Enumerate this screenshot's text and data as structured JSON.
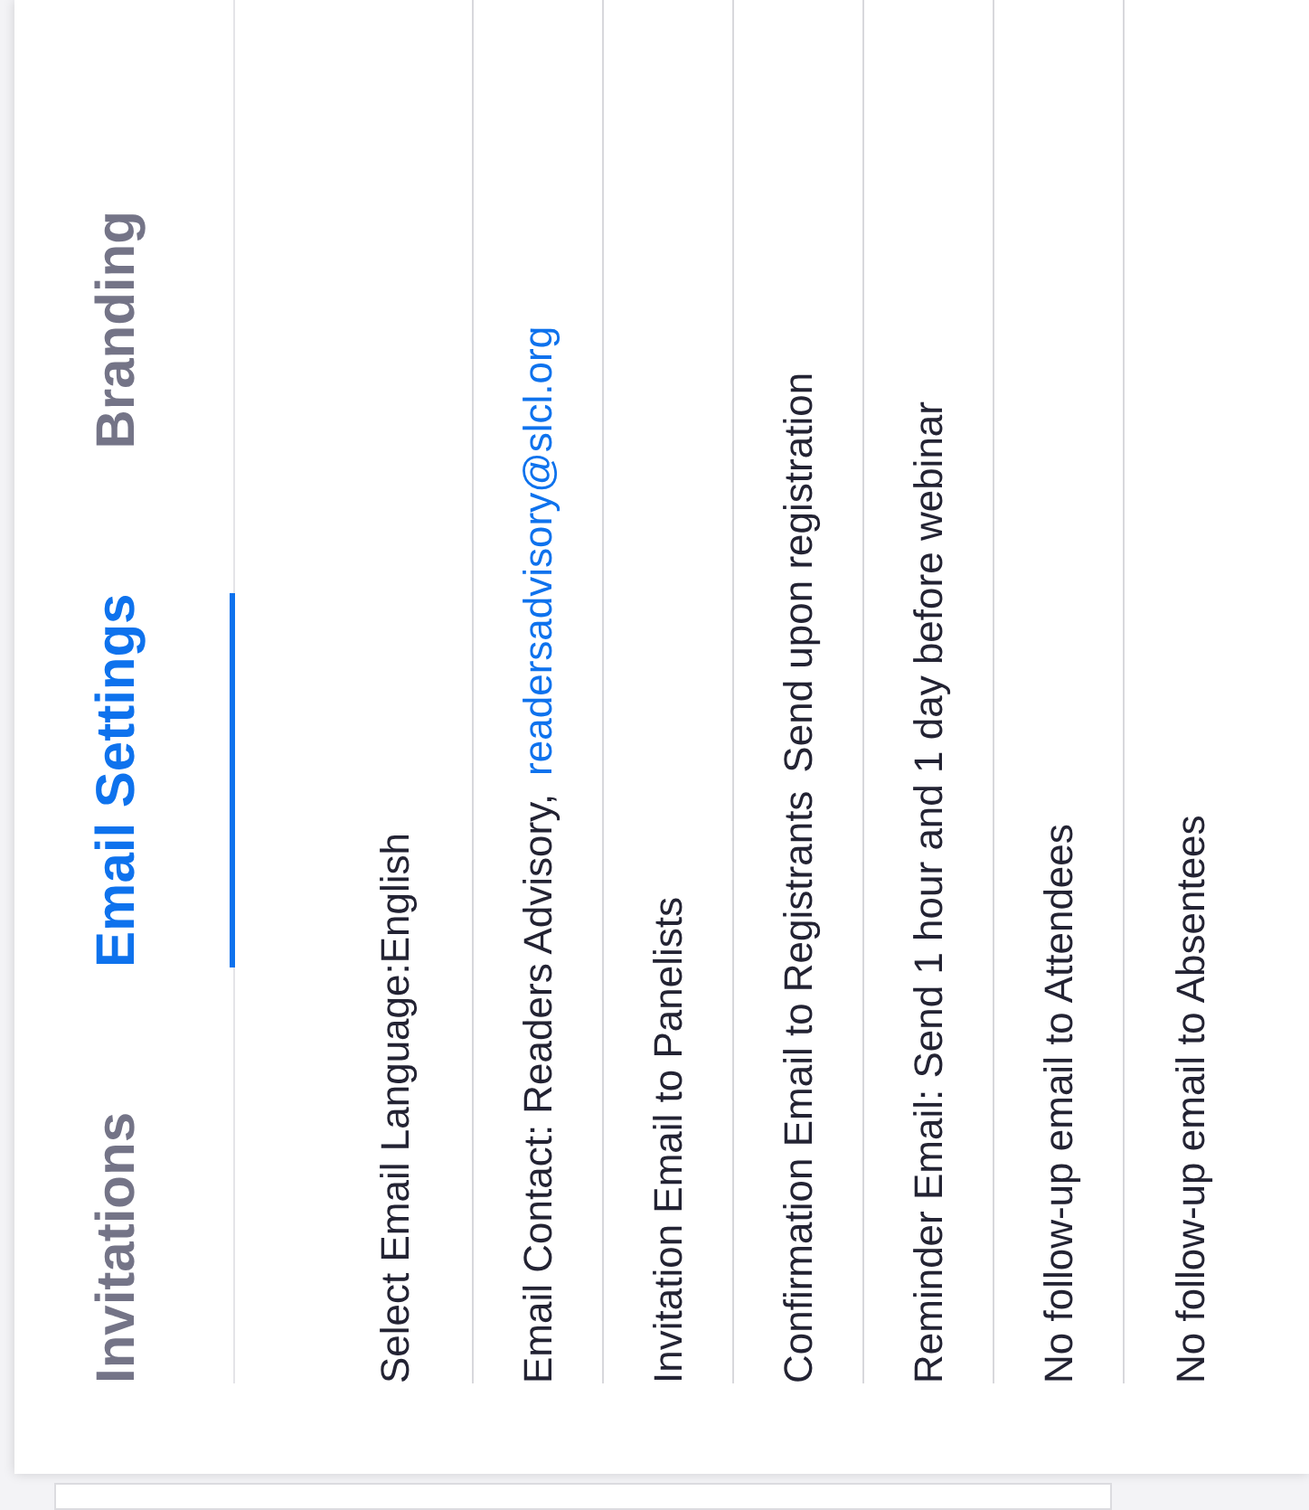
{
  "tabs": [
    {
      "label": "Invitations",
      "selected": false
    },
    {
      "label": "Email Settings",
      "selected": true
    },
    {
      "label": "Branding",
      "selected": false
    }
  ],
  "rows": [
    {
      "parts": [
        {
          "kind": "text",
          "text": "Select Email Language:English"
        }
      ]
    },
    {
      "parts": [
        {
          "kind": "text",
          "text": "Email Contact: Readers Advisory,"
        },
        {
          "kind": "link",
          "text": "readersadvisory@slcl.org"
        }
      ]
    },
    {
      "parts": [
        {
          "kind": "text",
          "text": "Invitation Email to Panelists"
        }
      ]
    },
    {
      "parts": [
        {
          "kind": "text",
          "text": "Confirmation Email to Registrants"
        },
        {
          "kind": "text",
          "text": "Send upon registration"
        }
      ]
    },
    {
      "parts": [
        {
          "kind": "text",
          "text": "Reminder Email: Send 1 hour and 1 day before webinar"
        }
      ]
    },
    {
      "parts": [
        {
          "kind": "text",
          "text": "No follow-up email to Attendees"
        }
      ]
    },
    {
      "parts": [
        {
          "kind": "text",
          "text": "No follow-up email to Absentees"
        }
      ]
    }
  ]
}
